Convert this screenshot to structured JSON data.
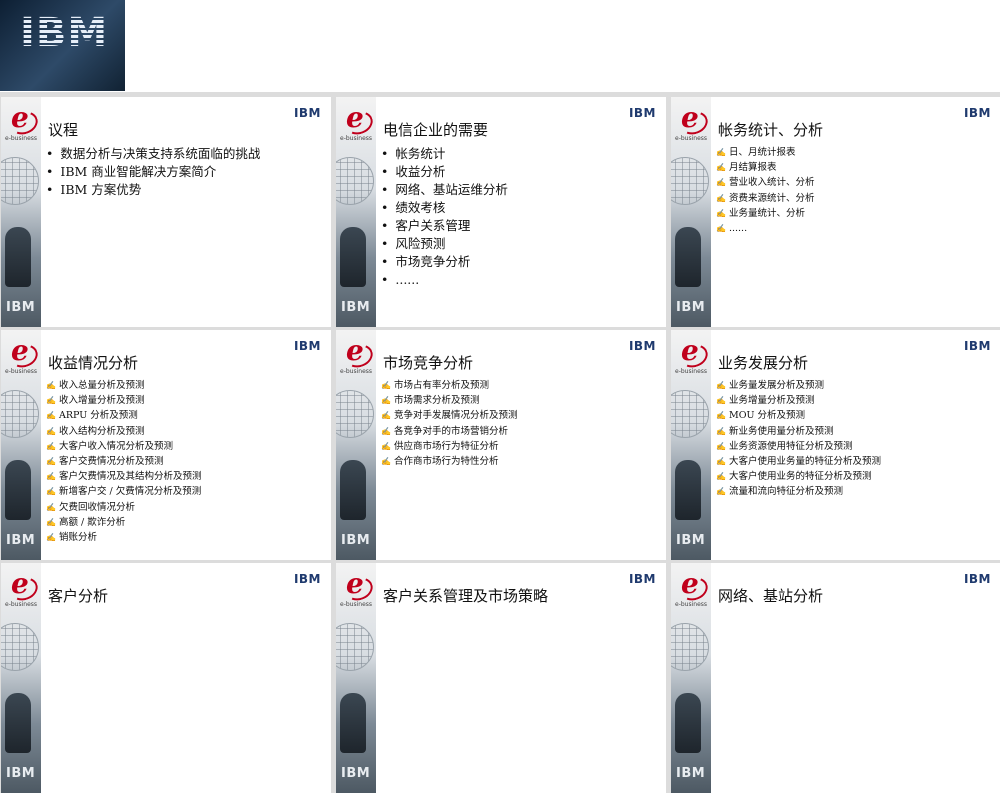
{
  "header": {
    "logo_text": "IBM"
  },
  "common": {
    "ibm_badge": "IBM",
    "ebusiness_label": "e-business",
    "side_logo": "IBM"
  },
  "slides": [
    {
      "title": "议程",
      "style": "bullet",
      "items": [
        "数据分析与决策支持系统面临的挑战",
        "IBM 商业智能解决方案简介",
        "IBM 方案优势"
      ]
    },
    {
      "title": "电信企业的需要",
      "style": "bullet",
      "items": [
        "帐务统计",
        "收益分析",
        "网络、基站运维分析",
        "绩效考核",
        "客户关系管理",
        "风险预测",
        "市场竞争分析",
        "......"
      ]
    },
    {
      "title": "帐务统计、分析",
      "style": "pen",
      "items": [
        "日、月统计报表",
        "月结算报表",
        "营业收入统计、分析",
        "资费来源统计、分析",
        "业务量统计、分析",
        "......"
      ]
    },
    {
      "title": "收益情况分析",
      "style": "pen",
      "items": [
        "收入总量分析及预测",
        "收入增量分析及预测",
        "ARPU 分析及预测",
        "收入结构分析及预测",
        "大客户收入情况分析及预测",
        "客户交费情况分析及预测",
        "客户欠费情况及其结构分析及预测",
        "新增客户交 / 欠费情况分析及预测",
        "欠费回收情况分析",
        "高额 / 欺诈分析",
        "销账分析"
      ]
    },
    {
      "title": "市场竞争分析",
      "style": "pen",
      "items": [
        "市场占有率分析及预测",
        "市场需求分析及预测",
        "竞争对手发展情况分析及预测",
        "各竞争对手的市场营销分析",
        "供应商市场行为特征分析",
        "合作商市场行为特性分析"
      ]
    },
    {
      "title": "业务发展分析",
      "style": "pen",
      "items": [
        "业务量发展分析及预测",
        "业务增量分析及预测",
        "MOU 分析及预测",
        "新业务使用量分析及预测",
        "业务资源使用特征分析及预测",
        "大客户使用业务量的特征分析及预测",
        "大客户使用业务的特征分析及预测",
        "流量和流向特征分析及预测"
      ]
    },
    {
      "title": "客户分析",
      "style": "pen",
      "items": []
    },
    {
      "title": "客户关系管理及市场策略",
      "style": "pen",
      "items": []
    },
    {
      "title": "网络、基站分析",
      "style": "pen",
      "items": []
    }
  ]
}
